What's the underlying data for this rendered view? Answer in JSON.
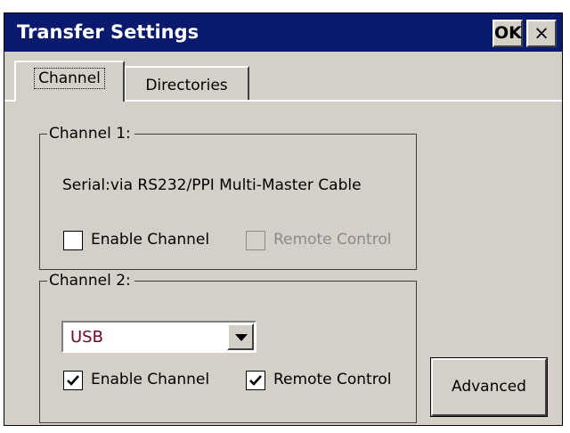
{
  "window": {
    "title": "Transfer Settings",
    "ok_label": "OK",
    "close_label": "×"
  },
  "tabs": [
    {
      "label": "Channel",
      "active": true
    },
    {
      "label": "Directories",
      "active": false
    }
  ],
  "channel1": {
    "legend": "Channel 1:",
    "connection_text": "Serial:via RS232/PPI Multi-Master Cable",
    "enable_channel": {
      "label": "Enable Channel",
      "checked": false,
      "enabled": true
    },
    "remote_control": {
      "label": "Remote Control",
      "checked": false,
      "enabled": false
    }
  },
  "channel2": {
    "legend": "Channel 2:",
    "connection_select": {
      "selected": "USB"
    },
    "enable_channel": {
      "label": "Enable Channel",
      "checked": true,
      "enabled": true
    },
    "remote_control": {
      "label": "Remote Control",
      "checked": true,
      "enabled": true
    }
  },
  "advanced_button": {
    "label": "Advanced"
  },
  "colors": {
    "titlebar": "#0a1a6e",
    "dialog_bg": "#d4d0c8",
    "select_text": "#7a0026",
    "disabled_text": "#8a8a8a"
  }
}
